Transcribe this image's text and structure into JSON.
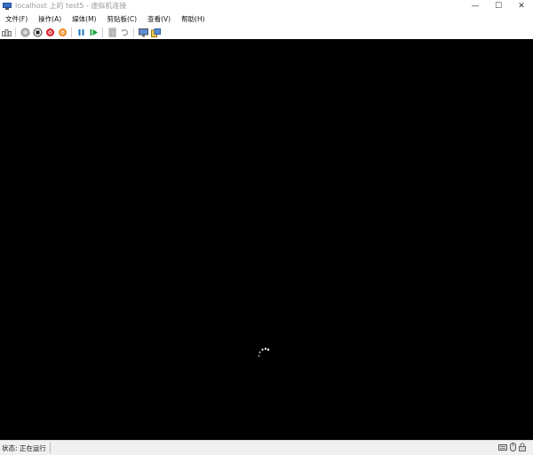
{
  "window": {
    "title": "localhost 上的 test5 - 虚拟机连接",
    "controls": {
      "minimize": "—",
      "maximize": "☐",
      "close": "✕"
    }
  },
  "menu": {
    "items": [
      {
        "label": "文件(F)"
      },
      {
        "label": "操作(A)"
      },
      {
        "label": "媒体(M)"
      },
      {
        "label": "剪贴板(C)"
      },
      {
        "label": "查看(V)"
      },
      {
        "label": "帮助(H)"
      }
    ]
  },
  "toolbar": {
    "icons": [
      "ctrl-alt-del-icon",
      "start-icon",
      "turn-off-icon",
      "shut-down-icon",
      "save-icon",
      "pause-icon",
      "resume-icon",
      "checkpoint-icon",
      "revert-icon",
      "enhanced-session-icon",
      "share-icon"
    ]
  },
  "status": {
    "text": "状态: 正在运行"
  },
  "colors": {
    "screen": "#000000",
    "title_text": "#9a9a9a",
    "turn_off_red": "#d8232a",
    "save_orange": "#f08a1c",
    "pause_blue": "#1e73c8",
    "resume_green": "#1aa33a"
  }
}
